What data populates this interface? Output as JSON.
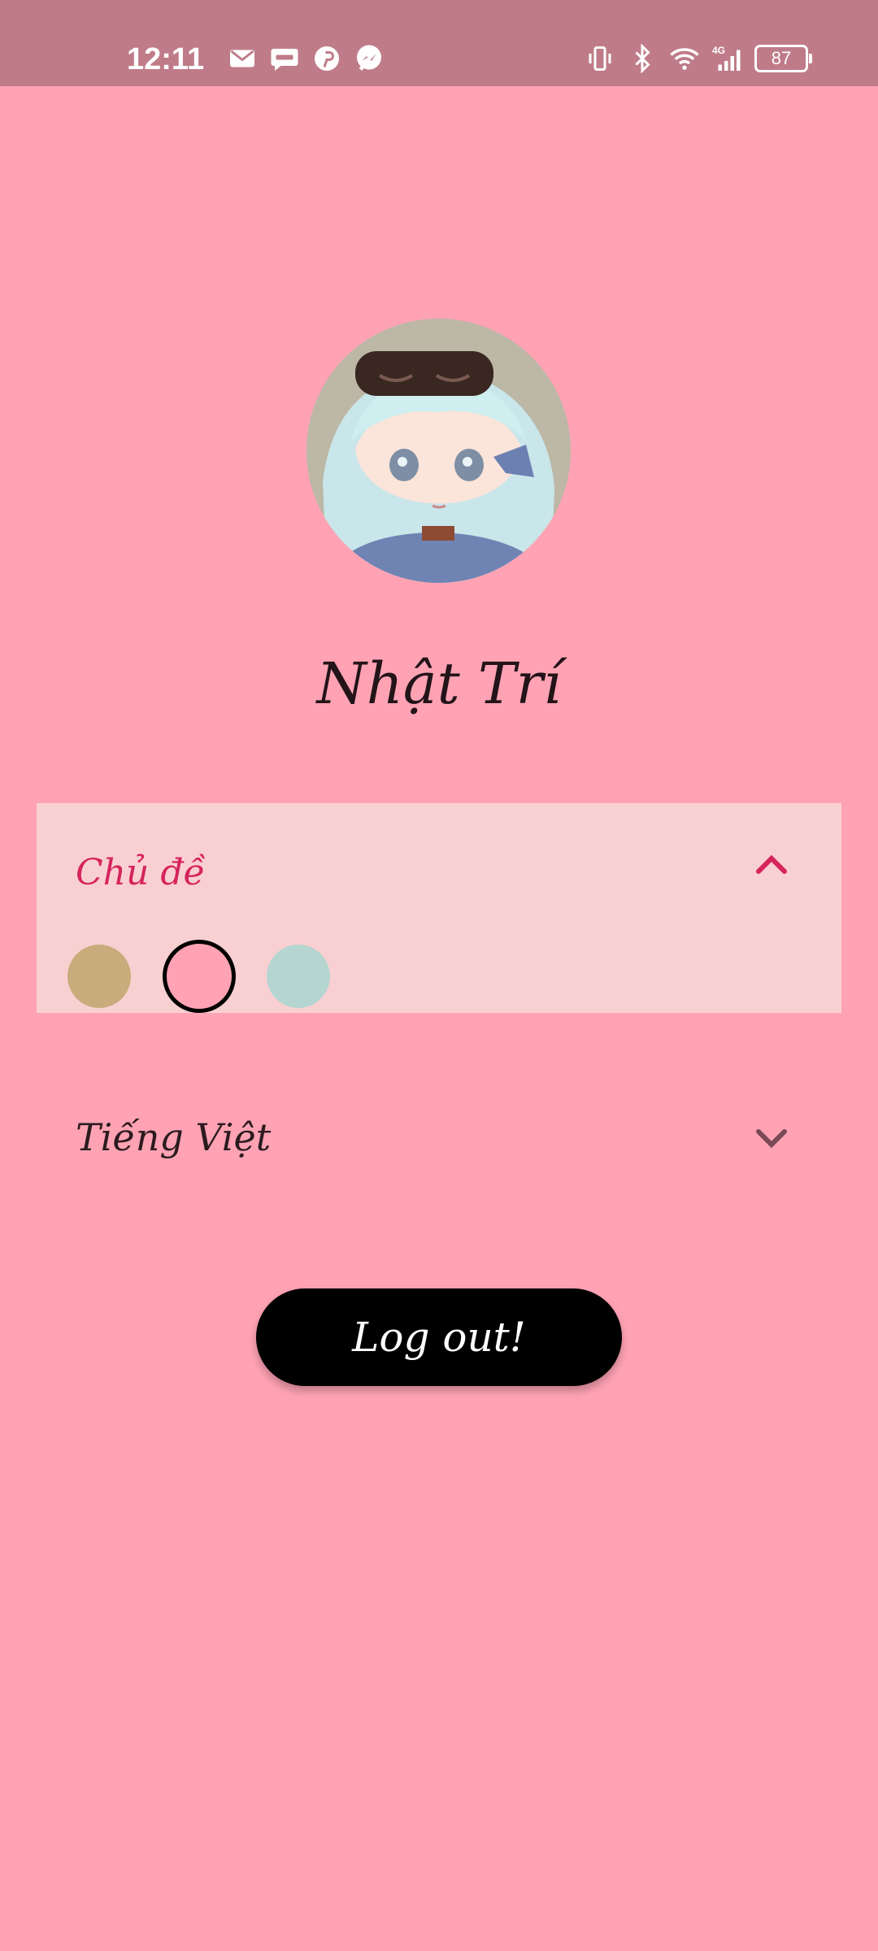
{
  "status_bar": {
    "time": "12:11",
    "battery": "87",
    "network": "4G",
    "notification_icons": [
      "mail-icon",
      "zalo-icon",
      "pinterest-icon",
      "messenger-icon"
    ],
    "system_icons": [
      "vibrate-icon",
      "bluetooth-icon",
      "wifi-icon",
      "signal-icon",
      "battery-icon"
    ]
  },
  "profile": {
    "name": "Nhật Trí"
  },
  "theme": {
    "label": "Chủ đề",
    "expanded": true,
    "options": [
      {
        "name": "gold",
        "color": "#c8ac7b",
        "selected": false
      },
      {
        "name": "pink",
        "color": "#ffa3b4",
        "selected": true
      },
      {
        "name": "mint",
        "color": "#b5d5d1",
        "selected": false
      }
    ],
    "accent": "#d6245c"
  },
  "language": {
    "label": "Tiếng Việt",
    "expanded": false
  },
  "logout": {
    "label": "Log out!"
  },
  "colors": {
    "background": "#ffa3b4",
    "status_bar": "#bf7c88",
    "panel": "#f9d0d2",
    "button": "#000000"
  }
}
